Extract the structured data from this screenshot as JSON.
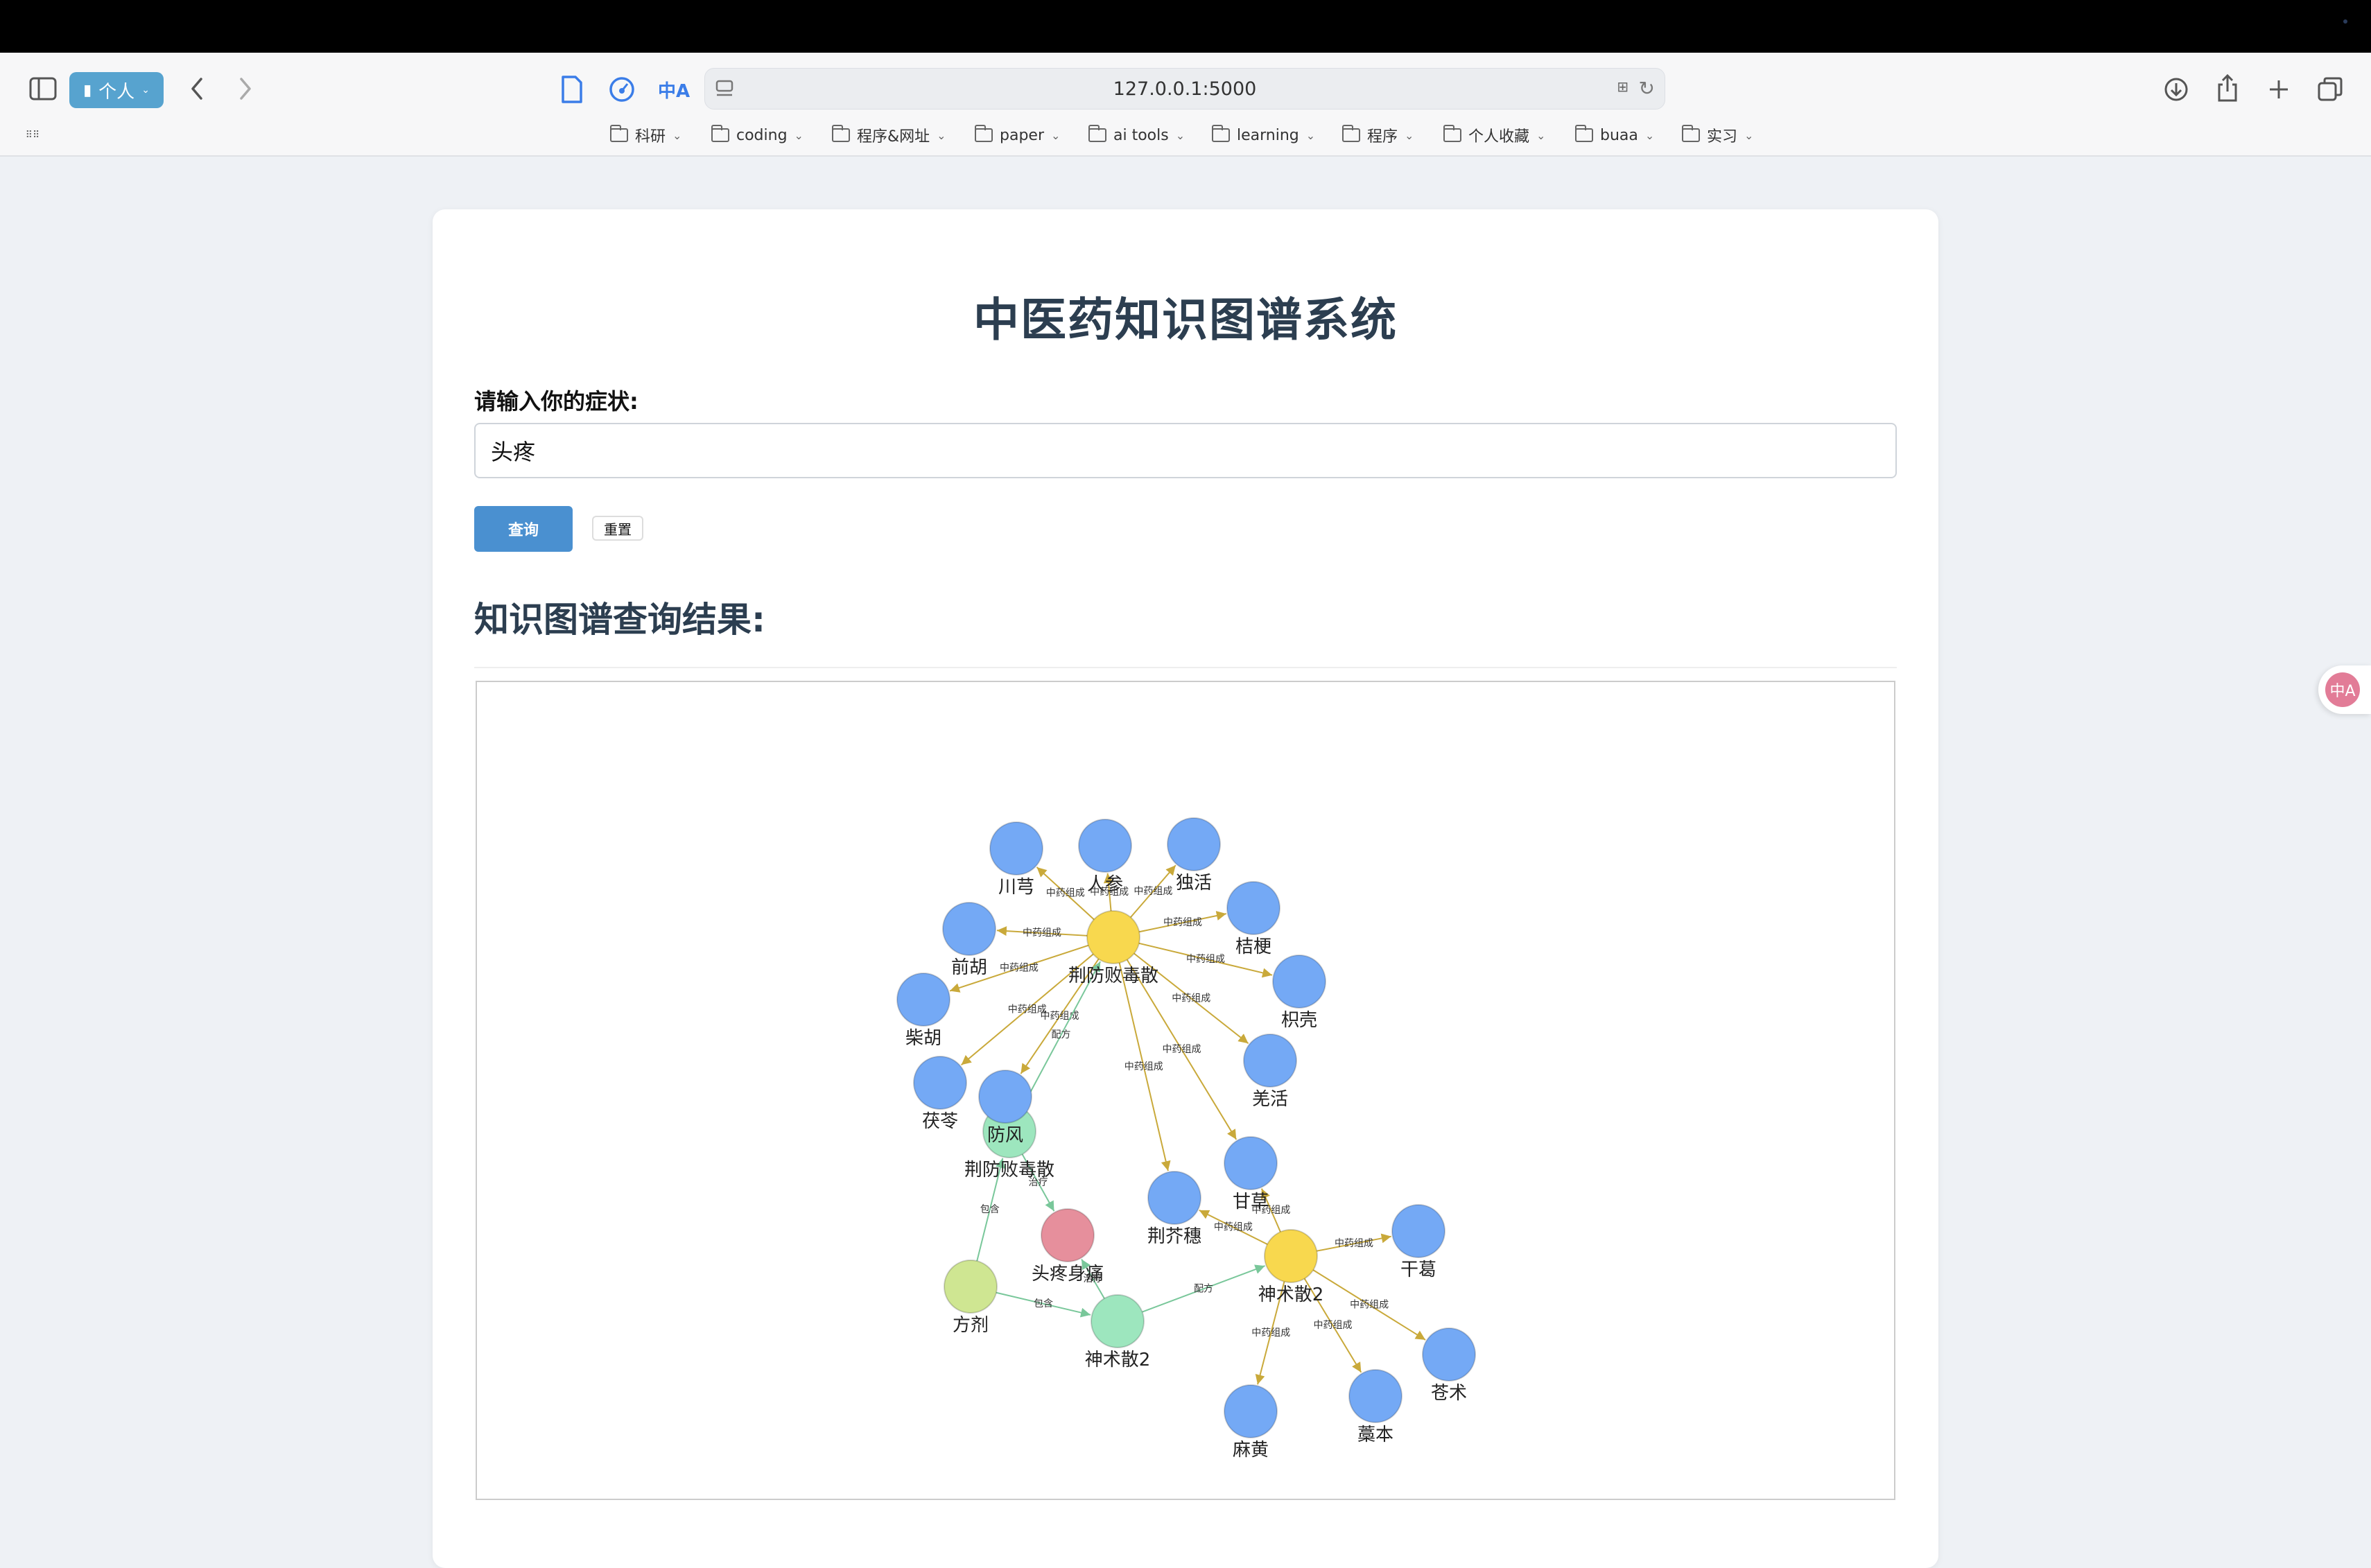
{
  "browser": {
    "profile_label": "个人",
    "url": "127.0.0.1:5000",
    "bookmarks": [
      {
        "label": "科研"
      },
      {
        "label": "coding"
      },
      {
        "label": "程序&网址"
      },
      {
        "label": "paper"
      },
      {
        "label": "ai tools"
      },
      {
        "label": "learning"
      },
      {
        "label": "程序"
      },
      {
        "label": "个人收藏"
      },
      {
        "label": "buaa"
      },
      {
        "label": "实习"
      }
    ]
  },
  "page": {
    "title": "中医药知识图谱系统",
    "symptom_label": "请输入你的症状:",
    "symptom_value": "头疼",
    "query_button": "查询",
    "reset_button": "重置",
    "result_title": "知识图谱查询结果:"
  },
  "graph": {
    "colors": {
      "herb": "#74a9f5",
      "formula": "#f8d84e",
      "prescription": "#9de6be",
      "symptom": "#e68f9c",
      "category": "#cfe692",
      "edge_herb": "#c9a93a",
      "edge_other": "#79c79a"
    },
    "nodes": [
      {
        "id": "jingfang",
        "label": "荆防败毒散",
        "type": "formula"
      },
      {
        "id": "shenzhu",
        "label": "神术散2",
        "type": "formula"
      },
      {
        "id": "jingfang_p",
        "label": "荆防败毒散",
        "type": "prescription"
      },
      {
        "id": "shenzhu_p",
        "label": "神术散2",
        "type": "prescription"
      },
      {
        "id": "headache",
        "label": "头疼身痛",
        "type": "symptom"
      },
      {
        "id": "fangji",
        "label": "方剂",
        "type": "category"
      },
      {
        "id": "chuanxiong",
        "label": "川芎",
        "type": "herb"
      },
      {
        "id": "renshen",
        "label": "人参",
        "type": "herb"
      },
      {
        "id": "duhuo",
        "label": "独活",
        "type": "herb"
      },
      {
        "id": "jiegeng",
        "label": "桔梗",
        "type": "herb"
      },
      {
        "id": "zhiqiao",
        "label": "枳壳",
        "type": "herb"
      },
      {
        "id": "qianghuo",
        "label": "羌活",
        "type": "herb"
      },
      {
        "id": "gancao",
        "label": "甘草",
        "type": "herb"
      },
      {
        "id": "jingjiesui",
        "label": "荆芥穗",
        "type": "herb"
      },
      {
        "id": "fangfeng",
        "label": "防风",
        "type": "herb"
      },
      {
        "id": "fuling",
        "label": "茯苓",
        "type": "herb"
      },
      {
        "id": "chaihu",
        "label": "柴胡",
        "type": "herb"
      },
      {
        "id": "qianhu",
        "label": "前胡",
        "type": "herb"
      },
      {
        "id": "gange",
        "label": "干葛",
        "type": "herb"
      },
      {
        "id": "cangzhu",
        "label": "苍术",
        "type": "herb"
      },
      {
        "id": "gaoben",
        "label": "藁本",
        "type": "herb"
      },
      {
        "id": "mahuang",
        "label": "麻黄",
        "type": "herb"
      }
    ],
    "edges": [
      {
        "from": "jingfang",
        "to": "chuanxiong",
        "label": "中药组成"
      },
      {
        "from": "jingfang",
        "to": "renshen",
        "label": "中药组成"
      },
      {
        "from": "jingfang",
        "to": "duhuo",
        "label": "中药组成"
      },
      {
        "from": "jingfang",
        "to": "jiegeng",
        "label": "中药组成"
      },
      {
        "from": "jingfang",
        "to": "zhiqiao",
        "label": "中药组成"
      },
      {
        "from": "jingfang",
        "to": "qianghuo",
        "label": "中药组成"
      },
      {
        "from": "jingfang",
        "to": "gancao",
        "label": "中药组成"
      },
      {
        "from": "jingfang",
        "to": "jingjiesui",
        "label": "中药组成"
      },
      {
        "from": "jingfang",
        "to": "fangfeng",
        "label": "中药组成"
      },
      {
        "from": "jingfang",
        "to": "fuling",
        "label": "中药组成"
      },
      {
        "from": "jingfang",
        "to": "chaihu",
        "label": "中药组成"
      },
      {
        "from": "jingfang",
        "to": "qianhu",
        "label": "中药组成"
      },
      {
        "from": "shenzhu",
        "to": "gancao",
        "label": "中药组成"
      },
      {
        "from": "shenzhu",
        "to": "jingjiesui",
        "label": "中药组成"
      },
      {
        "from": "shenzhu",
        "to": "gange",
        "label": "中药组成"
      },
      {
        "from": "shenzhu",
        "to": "cangzhu",
        "label": "中药组成"
      },
      {
        "from": "shenzhu",
        "to": "gaoben",
        "label": "中药组成"
      },
      {
        "from": "shenzhu",
        "to": "mahuang",
        "label": "中药组成"
      },
      {
        "from": "jingfang_p",
        "to": "jingfang",
        "label": "配方"
      },
      {
        "from": "shenzhu_p",
        "to": "shenzhu",
        "label": "配方"
      },
      {
        "from": "jingfang_p",
        "to": "headache",
        "label": "治疗"
      },
      {
        "from": "shenzhu_p",
        "to": "headache",
        "label": "治疗"
      },
      {
        "from": "fangji",
        "to": "jingfang_p",
        "label": "包含"
      },
      {
        "from": "fangji",
        "to": "shenzhu_p",
        "label": "包含"
      }
    ]
  }
}
